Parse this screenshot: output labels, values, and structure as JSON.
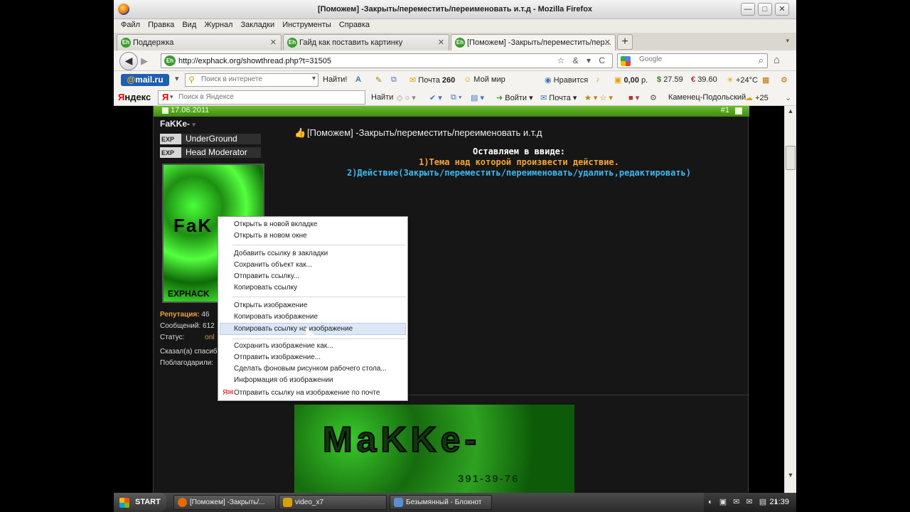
{
  "window": {
    "title": "[Поможем] -Закрыть/переместить/переименовать и.т.д - Mozilla Firefox",
    "minimize_glyph": "—",
    "maximize_glyph": "□",
    "close_glyph": "✕"
  },
  "menu": [
    "Файл",
    "Правка",
    "Вид",
    "Журнал",
    "Закладки",
    "Инструменты",
    "Справка"
  ],
  "tabs": [
    {
      "label": "Поддержка",
      "close": "✕"
    },
    {
      "label": "Гайд как поставить картинку",
      "close": "✕"
    },
    {
      "label": "[Поможем] -Закрыть/переместить/пер...",
      "close": "✕"
    }
  ],
  "tab_icon_text": "Eh",
  "newtab_glyph": "+",
  "nav": {
    "back_glyph": "◀",
    "forward_glyph": "▶",
    "url": "http://exphack.org/showthread.php?t=31505",
    "url_tools": "☆ & ▾ C",
    "search_placeholder": "Google",
    "search_glyph": "⌕",
    "home_glyph": "⌂"
  },
  "mailbar": {
    "logo_at": "@",
    "logo_text": "mail.ru",
    "search_placeholder": "Поиск в интернете",
    "find_label": "Найти!",
    "mail_label": "Почта",
    "mail_count": "260",
    "myworld_label": "Мой мир",
    "like_label": "Нравится",
    "balance": "0,00",
    "balance_unit": "р.",
    "usd": "27.59",
    "eur": "39.60",
    "temp": "+24°C"
  },
  "yabar": {
    "logo_prefix": "Я",
    "logo_rest": "ндекс",
    "search_mark": "Я",
    "search_placeholder": "Поиск в Яндексе",
    "find_label": "Найти",
    "login_label": "Войти",
    "mail_label": "Почта",
    "city": "Каменец-Подольский",
    "city_temp": "+25"
  },
  "post": {
    "date": "17.06.2011",
    "number": "#1",
    "username": "FaKKe-",
    "ranks": [
      "UnderGround",
      "Head Moderator"
    ],
    "rank_badge": "EXP",
    "avatar_text": "FaK",
    "avatar_sub": "EXPHACK",
    "rep_label": "Репутация:",
    "rep_value": "46",
    "posts_label": "Сообщений:",
    "posts_value": "612",
    "status_label": "Статус:",
    "status_value": "onl",
    "thanks_said": "Сказал(а) спасиб",
    "thanks_got": "Поблагодарили:",
    "title": "[Поможем] -Закрыть/переместить/переименовать и.т.д",
    "thumb_glyph": "👍",
    "line1": "Оставляем в ввиде:",
    "line2": "1)Тема над которой произвести действие.",
    "line3": "2)Действие(Закрыть/переместить/переименовать/удалить,редактировать)",
    "sig_text": "MaKKe-",
    "sig_sub": "391-39-76"
  },
  "context_menu": [
    "Открыть в новой вкладке",
    "Открыть в новом окне",
    "Добавить ссылку в закладки",
    "Сохранить объект как...",
    "Отправить ссылку...",
    "Копировать ссылку",
    "Открыть изображение",
    "Копировать изображение",
    "Копировать ссылку на изображение",
    "Сохранить изображение как...",
    "Отправить изображение...",
    "Сделать фоновым рисунком рабочего стола...",
    "Информация об изображении",
    "Отправить ссылку на изображение по почте"
  ],
  "taskbar": {
    "start_label": "START",
    "tasks": [
      "[Поможем] -Закрыть/...",
      "video_x7",
      "Безымянный - Блокнот"
    ],
    "clock": "21:39"
  },
  "colors": {
    "post_header": "#4f9a1f",
    "orange_text": "#f5a623",
    "blue_text": "#39b9f0",
    "menu_hover": "#dde8f6"
  }
}
